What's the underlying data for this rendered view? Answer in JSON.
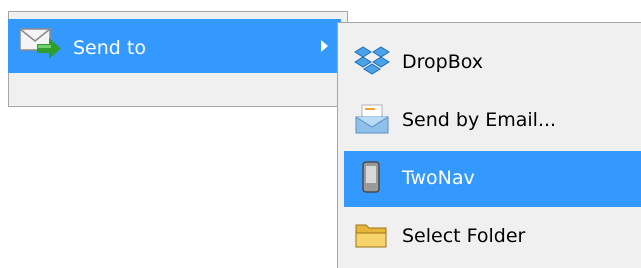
{
  "main_menu": {
    "item": {
      "label": "Send to",
      "icon": "send-mail-icon"
    }
  },
  "submenu": {
    "items": [
      {
        "label": "DropBox",
        "icon": "dropbox-icon",
        "selected": false
      },
      {
        "label": "Send by Email...",
        "icon": "email-envelope-icon",
        "selected": false
      },
      {
        "label": "TwoNav",
        "icon": "device-icon",
        "selected": true
      },
      {
        "label": "Select Folder",
        "icon": "folder-icon",
        "selected": false
      }
    ]
  },
  "colors": {
    "highlight": "#3399ff",
    "menu_background": "#f0f0f0",
    "border": "#a6a6a6"
  }
}
